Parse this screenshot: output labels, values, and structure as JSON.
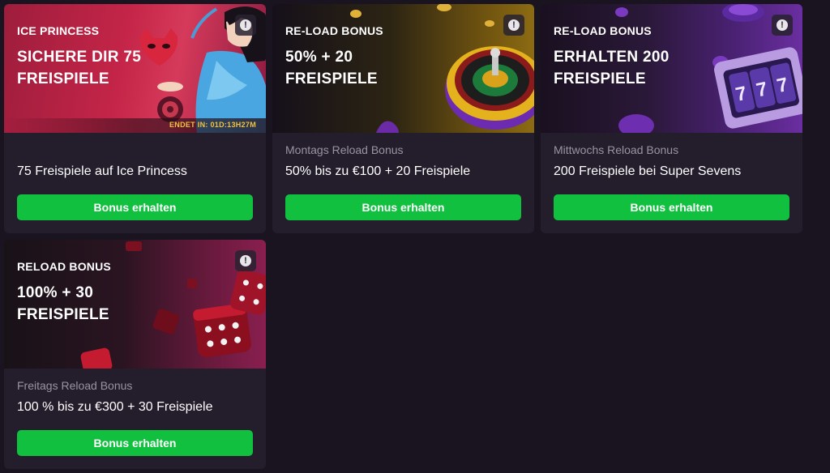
{
  "cards": [
    {
      "tag": "ICE PRINCESS",
      "headline": "SICHERE DIR 75 FREISPIELE",
      "ends_text": "ENDET IN: 01D:13H27M",
      "subtitle": "",
      "title": "75 Freispiele auf Ice Princess",
      "button": "Bonus erhalten",
      "info_icon": "exclamation-icon"
    },
    {
      "tag": "RE-LOAD BONUS",
      "headline": "50% + 20 FREISPIELE",
      "subtitle": "Montags Reload Bonus",
      "title": "50% bis zu €100 + 20 Freispiele",
      "button": "Bonus erhalten",
      "info_icon": "exclamation-icon"
    },
    {
      "tag": "RE-LOAD BONUS",
      "headline": "ERHALTEN 200 FREISPIELE",
      "subtitle": "Mittwochs Reload Bonus",
      "title": "200 Freispiele bei Super Sevens",
      "button": "Bonus erhalten",
      "info_icon": "exclamation-icon"
    },
    {
      "tag": "RELOAD BONUS",
      "headline": "100% + 30 FREISPIELE",
      "subtitle": "Freitags Reload Bonus",
      "title": "100 % bis zu €300 + 30 Freispiele",
      "button": "Bonus erhalten",
      "info_icon": "exclamation-icon"
    }
  ],
  "colors": {
    "background": "#1a1420",
    "card": "#241d2b",
    "button": "#12c040",
    "countdown": "#f4c23a",
    "subtitle": "#9a93a2"
  }
}
